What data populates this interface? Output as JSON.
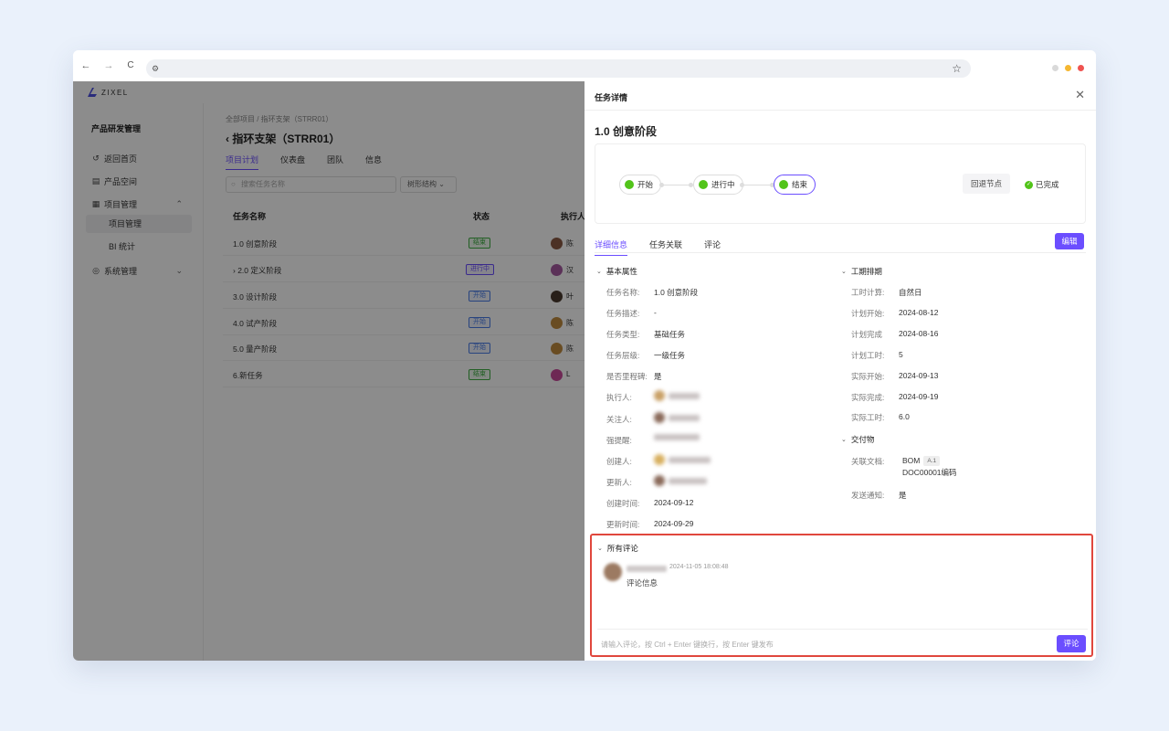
{
  "browser": {
    "back_icon": "←",
    "forward_icon": "→",
    "reload_icon": "C",
    "site_icon": "⚙",
    "star_icon": "☆",
    "window_dot_colors": [
      "#d9d9d9",
      "#f5b731",
      "#ef5350"
    ]
  },
  "brand": {
    "name": "ZIXEL"
  },
  "sidebar": {
    "title": "产品研发管理",
    "items": [
      {
        "icon": "↺",
        "label": "返回首页"
      },
      {
        "icon": "▤",
        "label": "产品空间"
      },
      {
        "icon": "▦",
        "label": "项目管理",
        "chevron": "⌃"
      },
      {
        "icon": "◎",
        "label": "系统管理",
        "chevron": "⌄"
      }
    ],
    "sub_items": [
      {
        "label": "项目管理"
      },
      {
        "label": "BI 统计"
      }
    ]
  },
  "main": {
    "breadcrumb": "全部项目 / 指环支架（STRR01）",
    "title": "‹ 指环支架（STRR01）",
    "tabs": [
      "项目计划",
      "仪表盘",
      "团队",
      "信息"
    ],
    "search_placeholder": "搜索任务名称",
    "search_icon": "○",
    "view_select": "树形结构 ⌄",
    "columns": [
      "任务名称",
      "状态",
      "执行人"
    ],
    "rows": [
      {
        "name": "1.0 创意阶段",
        "status": "结束",
        "assignee_initial": "陈",
        "avatar_color": "#8a5a44"
      },
      {
        "name": "› 2.0 定义阶段",
        "status": "进行中",
        "assignee_initial": "汉",
        "avatar_color": "#a65aa0"
      },
      {
        "name": "3.0 设计阶段",
        "status": "开始",
        "assignee_initial": "叶",
        "avatar_color": "#4a3a2e"
      },
      {
        "name": "4.0 试产阶段",
        "status": "开始",
        "assignee_initial": "陈",
        "avatar_color": "#c08a3e"
      },
      {
        "name": "5.0 量产阶段",
        "status": "开始",
        "assignee_initial": "陈",
        "avatar_color": "#c08a3e"
      },
      {
        "name": "6.新任务",
        "status": "结束",
        "assignee_initial": "L",
        "avatar_color": "#c84a9a"
      }
    ]
  },
  "drawer": {
    "header": "任务详情",
    "close_icon": "✕",
    "task_title": "1.0 创意阶段",
    "flow_nodes": [
      "开始",
      "进行中",
      "结束"
    ],
    "rollback_label": "回退节点",
    "completed_label": "已完成",
    "completed_icon": "✓",
    "tabs": [
      "详细信息",
      "任务关联",
      "评论"
    ],
    "edit_label": "编辑",
    "basic_section": "基本属性",
    "basic_fields": [
      {
        "key": "任务名称:",
        "value": "1.0 创意阶段"
      },
      {
        "key": "任务描述:",
        "value": "-"
      },
      {
        "key": "任务类型:",
        "value": "基础任务"
      },
      {
        "key": "任务层级:",
        "value": "一级任务"
      },
      {
        "key": "是否里程碑:",
        "value": "是"
      },
      {
        "key": "执行人:",
        "value": ""
      },
      {
        "key": "关注人:",
        "value": ""
      },
      {
        "key": "强提醒:",
        "value": ""
      },
      {
        "key": "创建人:",
        "value": ""
      },
      {
        "key": "更新人:",
        "value": ""
      },
      {
        "key": "创建时间:",
        "value": "2024-09-12"
      },
      {
        "key": "更新时间:",
        "value": "2024-09-29"
      }
    ],
    "schedule_section": "工期排期",
    "schedule_fields": [
      {
        "key": "工时计算:",
        "value": "自然日"
      },
      {
        "key": "计划开始:",
        "value": "2024-08-12"
      },
      {
        "key": "计划完成",
        "value": "2024-08-16"
      },
      {
        "key": "计划工时:",
        "value": "5"
      },
      {
        "key": "实际开始:",
        "value": "2024-09-13"
      },
      {
        "key": "实际完成:",
        "value": "2024-09-19"
      },
      {
        "key": "实际工时:",
        "value": "6.0"
      }
    ],
    "deliverable_section": "交付物",
    "deliverables": {
      "doc_key": "关联文档:",
      "doc_name": "BOM",
      "doc_version": "A.1",
      "doc_code": "DOC00001编码",
      "notify_key": "发送通知:",
      "notify_value": "是"
    },
    "comments": {
      "section": "所有评论",
      "time": "2024-11-05 18:08:48",
      "text": "评论信息",
      "input_placeholder": "请输入评论，按 Ctrl + Enter 键换行，按 Enter 键发布",
      "submit_label": "评论"
    }
  }
}
